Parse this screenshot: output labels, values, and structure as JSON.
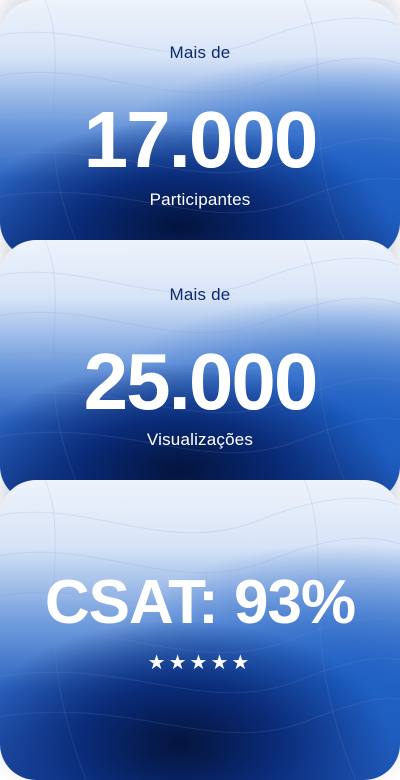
{
  "cards": [
    {
      "prefix": "Mais de",
      "value": "17.000",
      "label": "Participantes"
    },
    {
      "prefix": "Mais de",
      "value": "25.000",
      "label": "Visualizações"
    },
    {
      "value": "CSAT: 93%",
      "stars": "★★★★★",
      "rating": 5,
      "rating_max": 5
    }
  ],
  "colors": {
    "prefix_text": "#0f2a6b",
    "primary_text": "#ffffff",
    "deep_blue": "#04143d",
    "mid_blue": "#2b63c0",
    "light_blue": "#d7e4f7"
  }
}
